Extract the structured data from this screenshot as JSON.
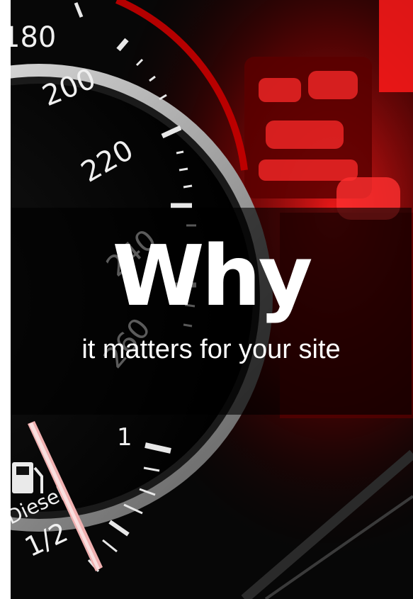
{
  "banner": {
    "headline": "Why",
    "subheadline": "it matters for your site"
  },
  "gauge": {
    "speed_labels": [
      "180",
      "200",
      "220",
      "240",
      "260"
    ],
    "fuel_label": "Diesel",
    "fuel_half": "1/2",
    "fuel_full": "1",
    "fuel_icon": "fuel-pump-icon"
  },
  "colors": {
    "accent_red": "#d40000",
    "needle": "#f0b0b0",
    "overlay": "#000000",
    "text": "#ffffff"
  }
}
